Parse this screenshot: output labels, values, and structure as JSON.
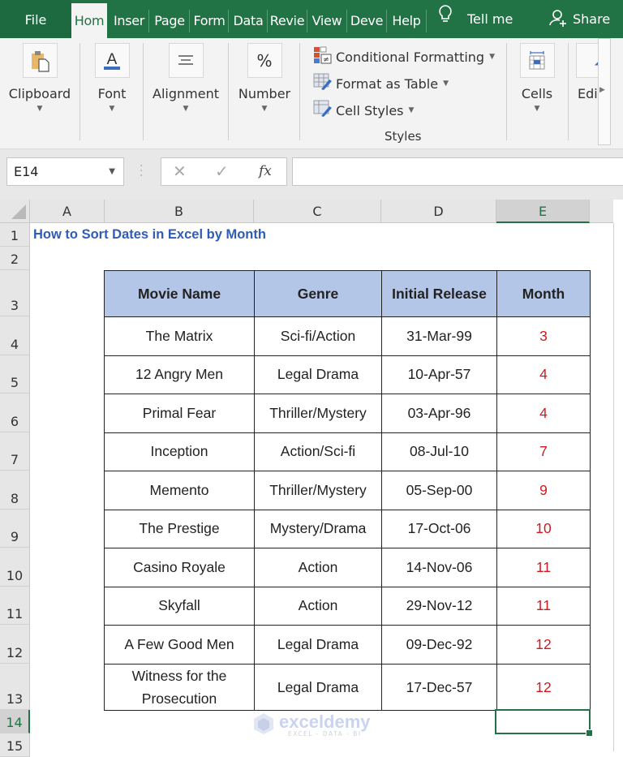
{
  "ribbon_tabs": {
    "file": "File",
    "items": [
      "Hom",
      "Inser",
      "Page",
      "Form",
      "Data",
      "Revie",
      "View",
      "Deve",
      "Help"
    ],
    "active": "Hom",
    "tell_me": "Tell me",
    "share": "Share"
  },
  "ribbon": {
    "groups": {
      "clipboard": "Clipboard",
      "font": "Font",
      "alignment": "Alignment",
      "number": "Number",
      "cells": "Cells",
      "editing": "Edi"
    },
    "styles": {
      "conditional_formatting": "Conditional Formatting",
      "format_as_table": "Format as Table",
      "cell_styles": "Cell Styles",
      "group_label": "Styles"
    },
    "number_icon_glyph": "%",
    "font_icon_glyph": "A"
  },
  "formula_bar": {
    "name_box": "E14",
    "fx_label": "fx",
    "formula": ""
  },
  "sheet": {
    "columns": [
      "A",
      "B",
      "C",
      "D",
      "E"
    ],
    "selected_column": "E",
    "rows": [
      "1",
      "2",
      "3",
      "4",
      "5",
      "6",
      "7",
      "8",
      "9",
      "10",
      "11",
      "12",
      "13",
      "14",
      "15"
    ],
    "selected_row": "14",
    "selected_cell": "E14",
    "title": "How to Sort Dates in Excel by Month",
    "accent_color": "#217346",
    "title_color": "#2e5cb8",
    "header_fill": "#b4c6e7",
    "month_color": "#d0191e",
    "table": {
      "headers": [
        "Movie Name",
        "Genre",
        "Initial Release",
        "Month"
      ],
      "rows": [
        [
          "The Matrix",
          "Sci-fi/Action",
          "31-Mar-99",
          "3"
        ],
        [
          "12 Angry Men",
          "Legal Drama",
          "10-Apr-57",
          "4"
        ],
        [
          "Primal Fear",
          "Thriller/Mystery",
          "03-Apr-96",
          "4"
        ],
        [
          "Inception",
          "Action/Sci-fi",
          "08-Jul-10",
          "7"
        ],
        [
          "Memento",
          "Thriller/Mystery",
          "05-Sep-00",
          "9"
        ],
        [
          "The Prestige",
          "Mystery/Drama",
          "17-Oct-06",
          "10"
        ],
        [
          "Casino Royale",
          "Action",
          "14-Nov-06",
          "11"
        ],
        [
          "Skyfall",
          "Action",
          "29-Nov-12",
          "11"
        ],
        [
          "A Few Good Men",
          "Legal Drama",
          "09-Dec-92",
          "12"
        ],
        [
          "Witness for the Prosecution",
          "Legal Drama",
          "17-Dec-57",
          "12"
        ]
      ]
    }
  },
  "watermark": {
    "name": "exceldemy",
    "tagline": "EXCEL - DATA - BI"
  }
}
